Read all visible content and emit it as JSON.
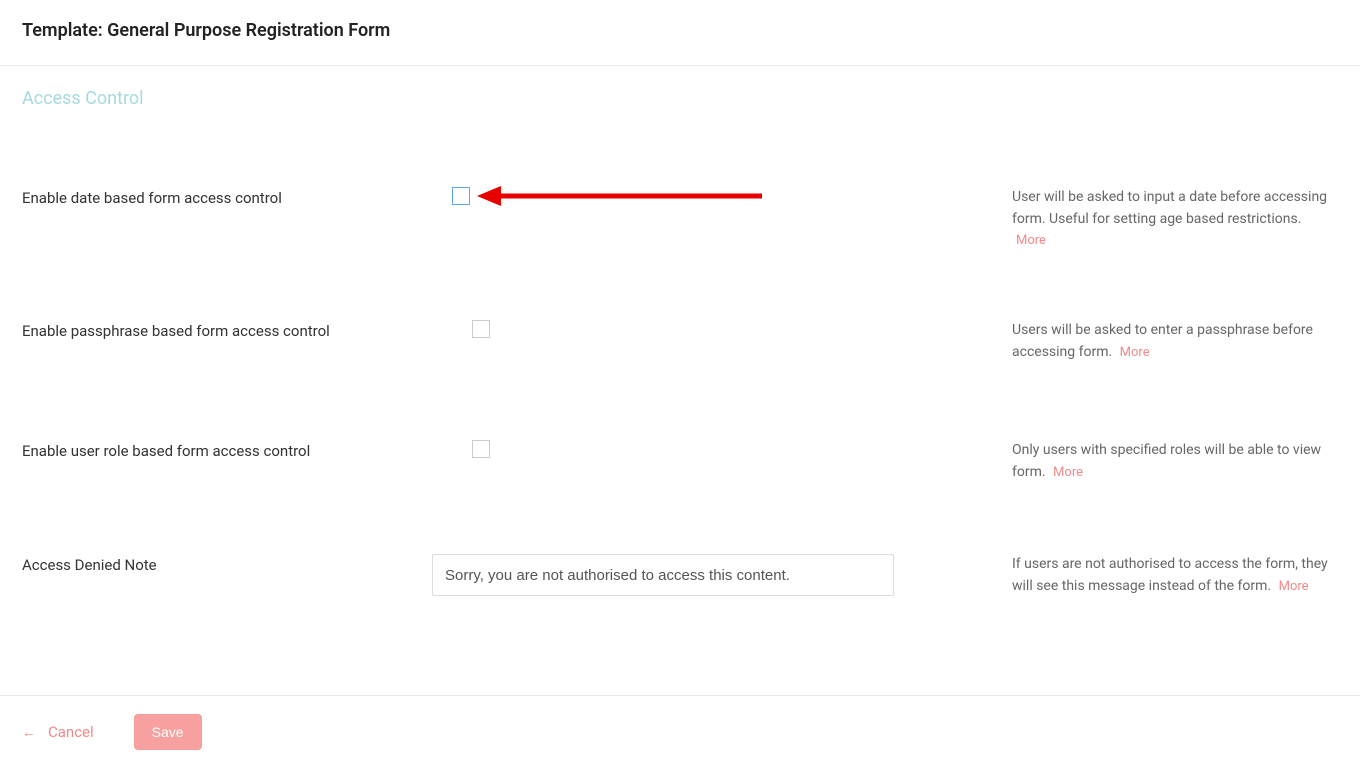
{
  "page_title": "Template: General Purpose Registration Form",
  "section_title": "Access Control",
  "rows": [
    {
      "label": "Enable date based form access control",
      "help": "User will be asked to input a date before accessing form. Useful for setting age based restrictions.",
      "more": "More"
    },
    {
      "label": "Enable passphrase based form access control",
      "help": "Users will be asked to enter a passphrase before accessing form.",
      "more": "More"
    },
    {
      "label": "Enable user role based form access control",
      "help": "Only users with specified roles will be able to view form.",
      "more": "More"
    },
    {
      "label": "Access Denied Note",
      "value": "Sorry, you are not authorised to access this content.",
      "help": "If users are not authorised to access the form, they will see this message instead of the form.",
      "more": "More"
    }
  ],
  "footer": {
    "cancel": "Cancel",
    "save": "Save"
  }
}
